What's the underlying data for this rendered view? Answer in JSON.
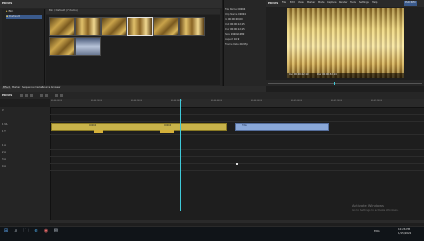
{
  "bin": {
    "title": "EDIUS",
    "folder_root": "Bin",
    "folder_selected": "Default",
    "toolbar_path": "Bin / Default (7 items)",
    "clips": [
      {
        "label": "C0001",
        "style": "gold"
      },
      {
        "label": "C0002",
        "style": "gold2"
      },
      {
        "label": "C0003",
        "style": "gold"
      },
      {
        "label": "C0004",
        "style": "gold2"
      },
      {
        "label": "C0005",
        "style": "gold"
      },
      {
        "label": "C0006",
        "style": "gold2"
      },
      {
        "label": "C0007",
        "style": "blue"
      }
    ]
  },
  "info": {
    "rows": [
      {
        "label": "File Name",
        "value": "C0004"
      },
      {
        "label": "Clip Name",
        "value": "C0004"
      },
      {
        "label": "In",
        "value": "00:00:00;00"
      },
      {
        "label": "Out",
        "value": "00:00:12;15"
      },
      {
        "label": "Dur",
        "value": "00:00:12;15"
      },
      {
        "label": "Size",
        "value": "1920x1080"
      },
      {
        "label": "Aspect",
        "value": "16:9"
      },
      {
        "label": "Frame Rate",
        "value": "29.97p"
      }
    ],
    "footer": "Information"
  },
  "player": {
    "menu_title": "EDIUS",
    "menu": [
      "File",
      "Edit",
      "View",
      "Marker",
      "Mode",
      "Capture",
      "Render",
      "Tools",
      "Settings",
      "Help"
    ],
    "mode": "PLR REC",
    "status_left": "Cur 00:00:22;19",
    "status_right": "Dur 00:00:32;14",
    "controls": [
      "⏮",
      "◀◀",
      "◀",
      "■",
      "▶",
      "▶▶",
      "⏭"
    ]
  },
  "timeline": {
    "title": "EDIUS",
    "tabs": [
      "Effect",
      "Marker",
      "Sequence marker",
      "Source browser"
    ],
    "ruler": [
      "00:00:00;00",
      "00:00:10;00",
      "00:00:20;00",
      "00:00:30;00",
      "00:00:40;00",
      "00:00:50;00",
      "00:01:00;00",
      "00:01:10;00",
      "00:01:20;00"
    ],
    "tracks": [
      "V",
      "1 VA",
      "1 T",
      "1 A",
      "2 A",
      "3 A",
      "4 A"
    ],
    "clip_video": {
      "name": "C0004",
      "name2": "C0004"
    },
    "clip_title": {
      "name": "Title"
    }
  },
  "taskbar": {
    "start": "⊞",
    "search": "⌕",
    "apps": [
      "🗀",
      "e",
      "◉",
      "✉"
    ],
    "time": "10:26 PM",
    "date": "1/15/2022",
    "tray": "ENG"
  },
  "watermark": {
    "line1": "Activate Windows",
    "line2": "Go to Settings to activate Windows."
  },
  "colors": {
    "accent": "#3a5a8c",
    "playhead": "#3fc9d9",
    "video_clip": "#c8b34a",
    "title_clip": "#8aa8d8"
  }
}
